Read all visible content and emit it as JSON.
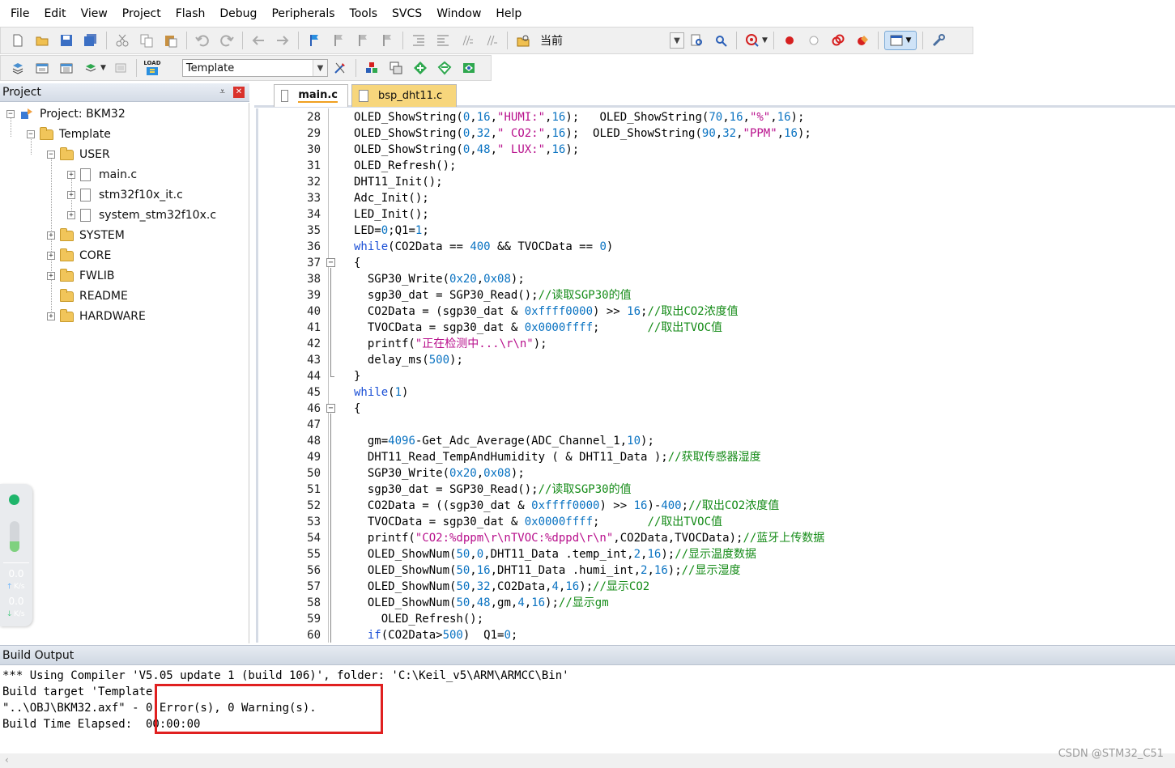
{
  "menu": [
    "File",
    "Edit",
    "View",
    "Project",
    "Flash",
    "Debug",
    "Peripherals",
    "Tools",
    "SVCS",
    "Window",
    "Help"
  ],
  "toolbar1": {
    "combo_value": "当前",
    "icons": [
      "new-file-icon",
      "open-file-icon",
      "save-icon",
      "save-all-icon",
      "cut-icon",
      "copy-icon",
      "paste-icon",
      "undo-icon",
      "redo-icon",
      "nav-back-icon",
      "nav-forward-icon",
      "bookmark-icon",
      "prev-bookmark-icon",
      "next-bookmark-icon",
      "clear-bookmarks-icon",
      "indent-icon",
      "unindent-icon",
      "comment-icon",
      "uncomment-icon",
      "find-in-files-icon",
      "find-icon",
      "incremental-find-icon",
      "debug-session-icon",
      "breakpoint-icon",
      "disable-breakpoint-icon",
      "kill-breakpoints-icon",
      "disable-all-breakpoints-icon",
      "window-layout-icon",
      "configure-icon"
    ]
  },
  "toolbar2": {
    "target_value": "Template",
    "load_icon_text": "LOAD",
    "icons": [
      "translate-icon",
      "build-icon",
      "rebuild-icon",
      "batch-build-icon",
      "stop-build-icon",
      "download-icon",
      "target-options-icon",
      "manage-project-icon",
      "file-extensions-icon",
      "pack-installer-icon",
      "select-packs-icon",
      "manage-rte-icon"
    ]
  },
  "project_pane": {
    "title": "Project",
    "pin": "⩡",
    "tree": [
      {
        "label": "Project: BKM32"
      },
      {
        "label": "Template"
      },
      {
        "label": "USER"
      },
      {
        "label": "main.c"
      },
      {
        "label": "stm32f10x_it.c"
      },
      {
        "label": "system_stm32f10x.c"
      },
      {
        "label": "SYSTEM"
      },
      {
        "label": "CORE"
      },
      {
        "label": "FWLIB"
      },
      {
        "label": "README"
      },
      {
        "label": "HARDWARE"
      }
    ]
  },
  "net_widget": {
    "status_color": "#1fb56b",
    "level": 0.35,
    "upload_speed": "0.0",
    "upload_unit": "K/s",
    "download_speed": "0.0",
    "download_unit": "K/s"
  },
  "tabs": [
    {
      "label": "main.c",
      "active": true
    },
    {
      "label": "bsp_dht11.c",
      "active": false
    }
  ],
  "editor": {
    "lines": [
      {
        "n": "28",
        "segs": [
          [
            "",
            "OLED_ShowString("
          ],
          [
            "num",
            "0"
          ],
          [
            "",
            ","
          ],
          [
            "num",
            "16"
          ],
          [
            "",
            ","
          ],
          [
            "str",
            "\"HUMI:\""
          ],
          [
            "",
            ","
          ],
          [
            "num",
            "16"
          ],
          [
            "",
            ");   OLED_ShowString("
          ],
          [
            "num",
            "70"
          ],
          [
            "",
            ","
          ],
          [
            "num",
            "16"
          ],
          [
            "",
            ","
          ],
          [
            "str",
            "\"%\""
          ],
          [
            "",
            ","
          ],
          [
            "num",
            "16"
          ],
          [
            "",
            ");"
          ]
        ]
      },
      {
        "n": "29",
        "segs": [
          [
            "",
            "OLED_ShowString("
          ],
          [
            "num",
            "0"
          ],
          [
            "",
            ","
          ],
          [
            "num",
            "32"
          ],
          [
            "",
            ","
          ],
          [
            "str",
            "\" CO2:\""
          ],
          [
            "",
            ","
          ],
          [
            "num",
            "16"
          ],
          [
            "",
            ");  OLED_ShowString("
          ],
          [
            "num",
            "90"
          ],
          [
            "",
            ","
          ],
          [
            "num",
            "32"
          ],
          [
            "",
            ","
          ],
          [
            "str",
            "\"PPM\""
          ],
          [
            "",
            ","
          ],
          [
            "num",
            "16"
          ],
          [
            "",
            ");"
          ]
        ]
      },
      {
        "n": "30",
        "segs": [
          [
            "",
            "OLED_ShowString("
          ],
          [
            "num",
            "0"
          ],
          [
            "",
            ","
          ],
          [
            "num",
            "48"
          ],
          [
            "",
            ","
          ],
          [
            "str",
            "\" LUX:\""
          ],
          [
            "",
            ","
          ],
          [
            "num",
            "16"
          ],
          [
            "",
            ");"
          ]
        ]
      },
      {
        "n": "31",
        "segs": [
          [
            "",
            "OLED_Refresh();"
          ]
        ]
      },
      {
        "n": "32",
        "segs": [
          [
            "",
            "DHT11_Init();"
          ]
        ]
      },
      {
        "n": "33",
        "segs": [
          [
            "",
            "Adc_Init();"
          ]
        ]
      },
      {
        "n": "34",
        "segs": [
          [
            "",
            "LED_Init();"
          ]
        ]
      },
      {
        "n": "35",
        "segs": [
          [
            "",
            "LED="
          ],
          [
            "num",
            "0"
          ],
          [
            "",
            ";Q1="
          ],
          [
            "num",
            "1"
          ],
          [
            "",
            ";"
          ]
        ]
      },
      {
        "n": "36",
        "segs": [
          [
            "kw",
            "while"
          ],
          [
            "",
            "(CO2Data == "
          ],
          [
            "num",
            "400"
          ],
          [
            "",
            " && TVOCData == "
          ],
          [
            "num",
            "0"
          ],
          [
            "",
            ")"
          ]
        ]
      },
      {
        "n": "37",
        "segs": [
          [
            "",
            "{"
          ]
        ]
      },
      {
        "n": "38",
        "segs": [
          [
            "",
            "  SGP30_Write("
          ],
          [
            "num",
            "0x20"
          ],
          [
            "",
            ","
          ],
          [
            "num",
            "0x08"
          ],
          [
            "",
            ");"
          ]
        ]
      },
      {
        "n": "39",
        "segs": [
          [
            "",
            "  sgp30_dat = SGP30_Read();"
          ],
          [
            "cm",
            "//读取SGP30的值"
          ]
        ]
      },
      {
        "n": "40",
        "segs": [
          [
            "",
            "  CO2Data = (sgp30_dat & "
          ],
          [
            "num",
            "0xffff0000"
          ],
          [
            "",
            ") >> "
          ],
          [
            "num",
            "16"
          ],
          [
            "",
            ";"
          ],
          [
            "cm",
            "//取出CO2浓度值"
          ]
        ]
      },
      {
        "n": "41",
        "segs": [
          [
            "",
            "  TVOCData = sgp30_dat & "
          ],
          [
            "num",
            "0x0000ffff"
          ],
          [
            "",
            ";       "
          ],
          [
            "cm",
            "//取出TVOC值"
          ]
        ]
      },
      {
        "n": "42",
        "segs": [
          [
            "",
            "  printf("
          ],
          [
            "str",
            "\"正在检测中...\\r\\n\""
          ],
          [
            "",
            ");"
          ]
        ]
      },
      {
        "n": "43",
        "segs": [
          [
            "",
            "  delay_ms("
          ],
          [
            "num",
            "500"
          ],
          [
            "",
            ");"
          ]
        ]
      },
      {
        "n": "44",
        "segs": [
          [
            "",
            "}"
          ]
        ]
      },
      {
        "n": "45",
        "segs": [
          [
            "kw",
            "while"
          ],
          [
            "",
            "("
          ],
          [
            "num",
            "1"
          ],
          [
            "",
            ")"
          ]
        ]
      },
      {
        "n": "46",
        "segs": [
          [
            "",
            "{"
          ]
        ]
      },
      {
        "n": "47",
        "segs": [
          [
            "",
            ""
          ]
        ]
      },
      {
        "n": "48",
        "segs": [
          [
            "",
            "  gm="
          ],
          [
            "num",
            "4096"
          ],
          [
            "",
            "-Get_Adc_Average(ADC_Channel_1,"
          ],
          [
            "num",
            "10"
          ],
          [
            "",
            ");"
          ]
        ]
      },
      {
        "n": "49",
        "segs": [
          [
            "",
            "  DHT11_Read_TempAndHumidity ( & DHT11_Data );"
          ],
          [
            "cm",
            "//获取传感器湿度"
          ]
        ]
      },
      {
        "n": "50",
        "segs": [
          [
            "",
            "  SGP30_Write("
          ],
          [
            "num",
            "0x20"
          ],
          [
            "",
            ","
          ],
          [
            "num",
            "0x08"
          ],
          [
            "",
            ");"
          ]
        ]
      },
      {
        "n": "51",
        "segs": [
          [
            "",
            "  sgp30_dat = SGP30_Read();"
          ],
          [
            "cm",
            "//读取SGP30的值"
          ]
        ]
      },
      {
        "n": "52",
        "segs": [
          [
            "",
            "  CO2Data = ((sgp30_dat & "
          ],
          [
            "num",
            "0xffff0000"
          ],
          [
            "",
            ") >> "
          ],
          [
            "num",
            "16"
          ],
          [
            "",
            ")-"
          ],
          [
            "num",
            "400"
          ],
          [
            "",
            ";"
          ],
          [
            "cm",
            "//取出CO2浓度值"
          ]
        ]
      },
      {
        "n": "53",
        "segs": [
          [
            "",
            "  TVOCData = sgp30_dat & "
          ],
          [
            "num",
            "0x0000ffff"
          ],
          [
            "",
            ";       "
          ],
          [
            "cm",
            "//取出TVOC值"
          ]
        ]
      },
      {
        "n": "54",
        "segs": [
          [
            "",
            "  printf("
          ],
          [
            "str",
            "\"CO2:%dppm\\r\\nTVOC:%dppd\\r\\n\""
          ],
          [
            "",
            ",CO2Data,TVOCData);"
          ],
          [
            "cm",
            "//蓝牙上传数据"
          ]
        ]
      },
      {
        "n": "55",
        "segs": [
          [
            "",
            "  OLED_ShowNum("
          ],
          [
            "num",
            "50"
          ],
          [
            "",
            ","
          ],
          [
            "num",
            "0"
          ],
          [
            "",
            ",DHT11_Data .temp_int,"
          ],
          [
            "num",
            "2"
          ],
          [
            "",
            ","
          ],
          [
            "num",
            "16"
          ],
          [
            "",
            ");"
          ],
          [
            "cm",
            "//显示温度数据"
          ]
        ]
      },
      {
        "n": "56",
        "segs": [
          [
            "",
            "  OLED_ShowNum("
          ],
          [
            "num",
            "50"
          ],
          [
            "",
            ","
          ],
          [
            "num",
            "16"
          ],
          [
            "",
            ",DHT11_Data .humi_int,"
          ],
          [
            "num",
            "2"
          ],
          [
            "",
            ","
          ],
          [
            "num",
            "16"
          ],
          [
            "",
            ");"
          ],
          [
            "cm",
            "//显示湿度"
          ]
        ]
      },
      {
        "n": "57",
        "segs": [
          [
            "",
            "  OLED_ShowNum("
          ],
          [
            "num",
            "50"
          ],
          [
            "",
            ","
          ],
          [
            "num",
            "32"
          ],
          [
            "",
            ",CO2Data,"
          ],
          [
            "num",
            "4"
          ],
          [
            "",
            ","
          ],
          [
            "num",
            "16"
          ],
          [
            "",
            ");"
          ],
          [
            "cm",
            "//显示CO2"
          ]
        ]
      },
      {
        "n": "58",
        "segs": [
          [
            "",
            "  OLED_ShowNum("
          ],
          [
            "num",
            "50"
          ],
          [
            "",
            ","
          ],
          [
            "num",
            "48"
          ],
          [
            "",
            ",gm,"
          ],
          [
            "num",
            "4"
          ],
          [
            "",
            ","
          ],
          [
            "num",
            "16"
          ],
          [
            "",
            ");"
          ],
          [
            "cm",
            "//显示gm"
          ]
        ]
      },
      {
        "n": "59",
        "segs": [
          [
            "",
            "    OLED_Refresh();"
          ]
        ]
      },
      {
        "n": "60",
        "segs": [
          [
            "",
            "  "
          ],
          [
            "kw",
            "if"
          ],
          [
            "",
            "(CO2Data>"
          ],
          [
            "num",
            "500"
          ],
          [
            "",
            ")  Q1="
          ],
          [
            "num",
            "0"
          ],
          [
            "",
            ";"
          ]
        ]
      }
    ]
  },
  "build_output": {
    "title": "Build Output",
    "lines": [
      "*** Using Compiler 'V5.05 update 1 (build 106)', folder: 'C:\\Keil_v5\\ARM\\ARMCC\\Bin'",
      "Build target 'Template'",
      "\"..\\OBJ\\BKM32.axf\" - 0 Error(s), 0 Warning(s).",
      "Build Time Elapsed:  00:00:00"
    ]
  },
  "watermark": "CSDN @STM32_C51",
  "colors": {
    "highlight_box": "#e02020",
    "active_tab_underline": "#f0a020"
  }
}
